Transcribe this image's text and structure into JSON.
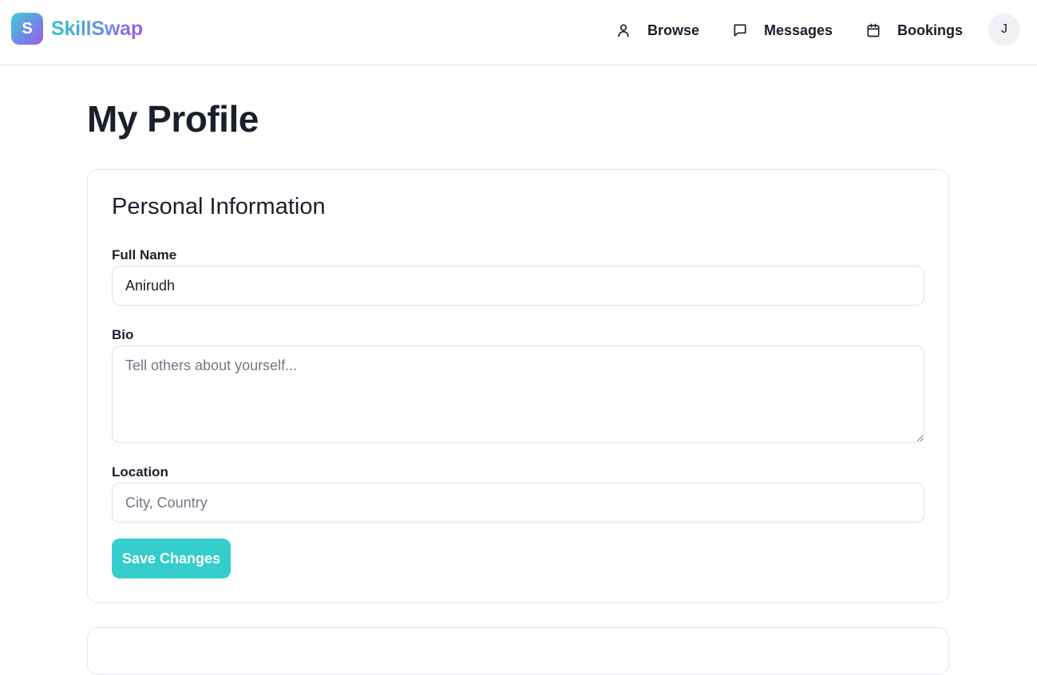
{
  "brand": {
    "logo_letter": "S",
    "name": "SkillSwap"
  },
  "nav": {
    "items": [
      {
        "label": "Browse",
        "icon": "user-icon"
      },
      {
        "label": "Messages",
        "icon": "message-square-icon"
      },
      {
        "label": "Bookings",
        "icon": "calendar-icon"
      }
    ],
    "avatar_initial": "J"
  },
  "page": {
    "title": "My Profile"
  },
  "personal_info": {
    "section_title": "Personal Information",
    "full_name": {
      "label": "Full Name",
      "value": "Anirudh"
    },
    "bio": {
      "label": "Bio",
      "value": "",
      "placeholder": "Tell others about yourself..."
    },
    "location": {
      "label": "Location",
      "value": "",
      "placeholder": "City, Country"
    },
    "save_label": "Save Changes"
  },
  "colors": {
    "accent": "#35cdcb",
    "brand_gradient_start": "#2fc4c6",
    "brand_gradient_end": "#9b5de5",
    "text": "#1a1f2b",
    "border": "#e3e5e9"
  }
}
